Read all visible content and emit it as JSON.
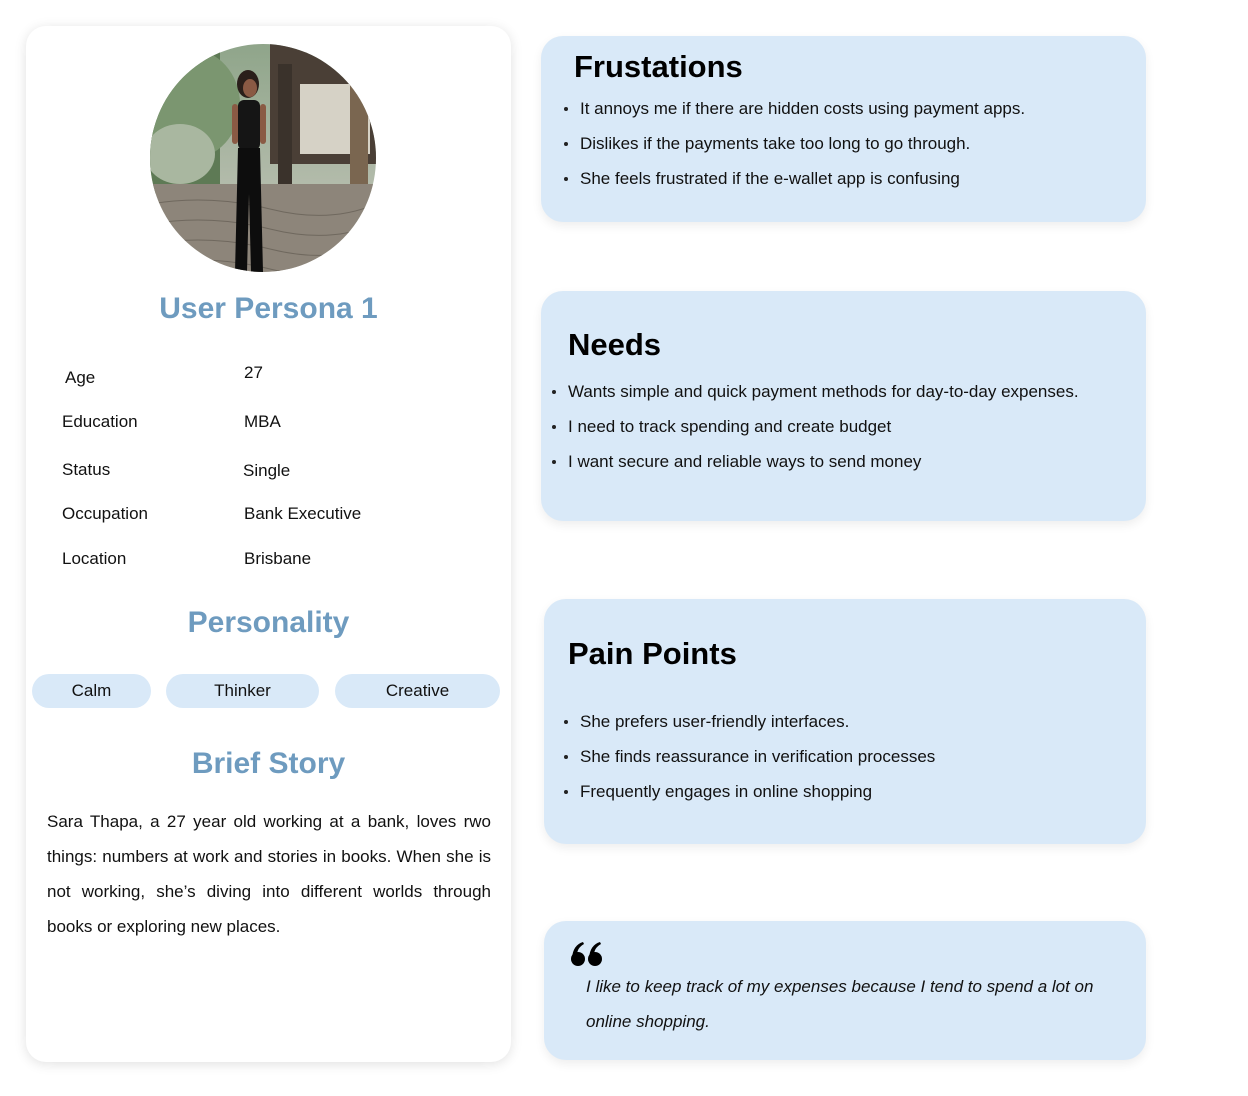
{
  "persona": {
    "avatar_icon": "woman-photo",
    "title": "User Persona 1",
    "details": [
      {
        "label": "Age",
        "value": "27"
      },
      {
        "label": "Education",
        "value": "MBA"
      },
      {
        "label": "Status",
        "value": "Single"
      },
      {
        "label": "Occupation",
        "value": "Bank Executive"
      },
      {
        "label": "Location",
        "value": "Brisbane"
      }
    ],
    "personality_heading": "Personality",
    "personality_tags": [
      "Calm",
      "Thinker",
      "Creative"
    ],
    "story_heading": "Brief Story",
    "story": "Sara Thapa, a 27 year old working at a bank, loves rwo things: numbers at work and stories in books. When she is not working, she’s diving into different worlds through books or exploring new places."
  },
  "frustrations": {
    "title": "Frustations",
    "items": [
      "It annoys me if there are hidden costs using payment apps.",
      "Dislikes if the payments take too long to go through.",
      "She feels frustrated if the e-wallet app is confusing"
    ]
  },
  "needs": {
    "title": "Needs",
    "items": [
      "Wants simple and quick payment methods for day-to-day expenses.",
      "I need to track spending and create budget",
      "I want secure and reliable ways to send money"
    ]
  },
  "pain_points": {
    "title": "Pain Points",
    "items": [
      "She prefers user-friendly interfaces.",
      "She finds reassurance in verification processes",
      "Frequently engages in online shopping"
    ]
  },
  "quote": {
    "icon": "quote-mark-icon",
    "text": "I like to keep track of my expenses because I tend to spend a lot on online shopping."
  },
  "colors": {
    "accent_heading": "#6e9bbf",
    "box_background": "#d9e9f8",
    "text": "#111111"
  }
}
